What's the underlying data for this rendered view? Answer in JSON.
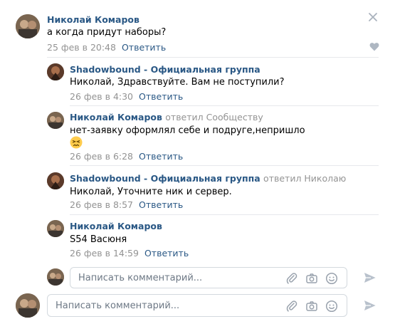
{
  "comments": [
    {
      "author": "Николай Комаров",
      "reply_to": "",
      "text": "а когда придут наборы?",
      "date": "25 фев в 20:48",
      "reply_label": "Ответить"
    },
    {
      "author": "Shadowbound - Официальная группа",
      "reply_to": "",
      "text": "Николай, Здравствуйте. Вам не поступили?",
      "date": "26 фев в 4:30",
      "reply_label": "Ответить"
    },
    {
      "author": "Николай Комаров",
      "reply_to": "ответил Сообществу",
      "text": "нет-заявку оформлял себе и подруге,непришло",
      "emoji": "persevering-face",
      "date": "26 фев в 6:28",
      "reply_label": "Ответить"
    },
    {
      "author": "Shadowbound - Официальная группа",
      "reply_to": "ответил Николаю",
      "text": "Николай, Уточните ник и сервер.",
      "date": "26 фев в 8:57",
      "reply_label": "Ответить"
    },
    {
      "author": "Николай Комаров",
      "reply_to": "",
      "text": "S54 Васюня",
      "date": "26 фев в 14:59",
      "reply_label": "Ответить"
    }
  ],
  "reply_input": {
    "placeholder": "Написать комментарий..."
  },
  "main_input": {
    "placeholder": "Написать комментарий..."
  },
  "icons": [
    "close-icon",
    "heart-icon",
    "paperclip-icon",
    "camera-icon",
    "smile-icon",
    "send-icon"
  ],
  "colors": {
    "link": "#2a5885",
    "muted": "#939393",
    "separator": "#e7e8ec",
    "border": "#d3d9de"
  }
}
